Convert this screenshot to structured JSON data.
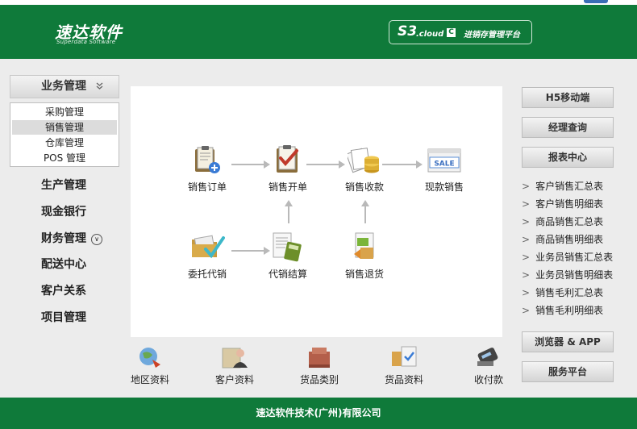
{
  "header": {
    "logo_cn": "速达软件",
    "logo_en": "Superdata Software",
    "product_s3": "S3",
    "product_cloud": ".cloud",
    "product_badge": "C",
    "product_platform": "进销存管理平台"
  },
  "nav": {
    "active_section": "业务管理",
    "submenu": [
      "采购管理",
      "销售管理",
      "仓库管理",
      "POS 管理"
    ],
    "active_sub": "销售管理",
    "items": [
      "生产管理",
      "现金银行",
      "财务管理",
      "配送中心",
      "客户关系",
      "项目管理"
    ]
  },
  "flow": {
    "nodes": {
      "sales_order": "销售订单",
      "sales_invoice": "销售开单",
      "sales_receipt": "销售收款",
      "cash_sale": "现款销售",
      "consign_out": "委托代销",
      "consign_settle": "代销结算",
      "sales_return": "销售退货"
    },
    "sale_tag": "SALE"
  },
  "right": {
    "buttons": [
      "H5移动端",
      "经理查询",
      "报表中心"
    ],
    "reports": [
      "客户销售汇总表",
      "客户销售明细表",
      "商品销售汇总表",
      "商品销售明细表",
      "业务员销售汇总表",
      "业务员销售明细表",
      "销售毛利汇总表",
      "销售毛利明细表"
    ],
    "bottom_buttons": [
      "浏览器 & APP",
      "服务平台"
    ]
  },
  "bottom_icons": [
    "地区资料",
    "客户资料",
    "货品类别",
    "货品资料",
    "收付款"
  ],
  "footer": "速达软件技术(广州)有限公司",
  "colors": {
    "brand_green": "#0f7a3a",
    "arrow_gray": "#b9b9b9"
  }
}
